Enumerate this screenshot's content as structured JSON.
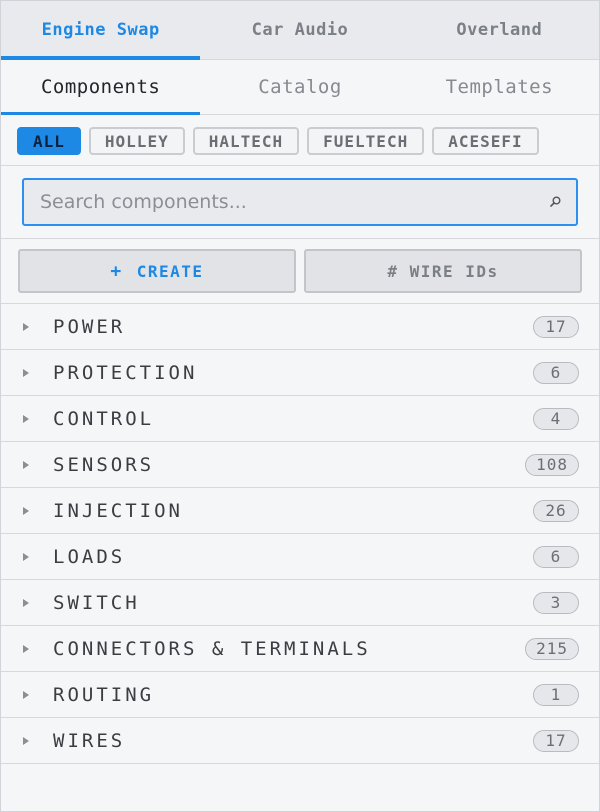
{
  "top_tabs": [
    {
      "label": "Engine Swap",
      "active": true
    },
    {
      "label": "Car Audio",
      "active": false
    },
    {
      "label": "Overland",
      "active": false
    }
  ],
  "sub_tabs": [
    {
      "label": "Components",
      "active": true
    },
    {
      "label": "Catalog",
      "active": false
    },
    {
      "label": "Templates",
      "active": false
    }
  ],
  "filters": [
    {
      "label": "ALL",
      "active": true
    },
    {
      "label": "HOLLEY",
      "active": false
    },
    {
      "label": "HALTECH",
      "active": false
    },
    {
      "label": "FUELTECH",
      "active": false
    },
    {
      "label": "ACESEFI",
      "active": false
    }
  ],
  "search": {
    "placeholder": "Search components...",
    "icon": "search-icon"
  },
  "actions": {
    "create_icon": "+",
    "create_label": "CREATE",
    "wire_ids_label": "# WIRE IDs"
  },
  "categories": [
    {
      "label": "POWER",
      "count": "17"
    },
    {
      "label": "PROTECTION",
      "count": "6"
    },
    {
      "label": "CONTROL",
      "count": "4"
    },
    {
      "label": "SENSORS",
      "count": "108"
    },
    {
      "label": "INJECTION",
      "count": "26"
    },
    {
      "label": "LOADS",
      "count": "6"
    },
    {
      "label": "SWITCH",
      "count": "3"
    },
    {
      "label": "CONNECTORS & TERMINALS",
      "count": "215"
    },
    {
      "label": "ROUTING",
      "count": "1"
    },
    {
      "label": "WIRES",
      "count": "17"
    }
  ],
  "colors": {
    "accent": "#1e88e5",
    "background": "#f5f6f8",
    "border": "#d6d8dc"
  }
}
